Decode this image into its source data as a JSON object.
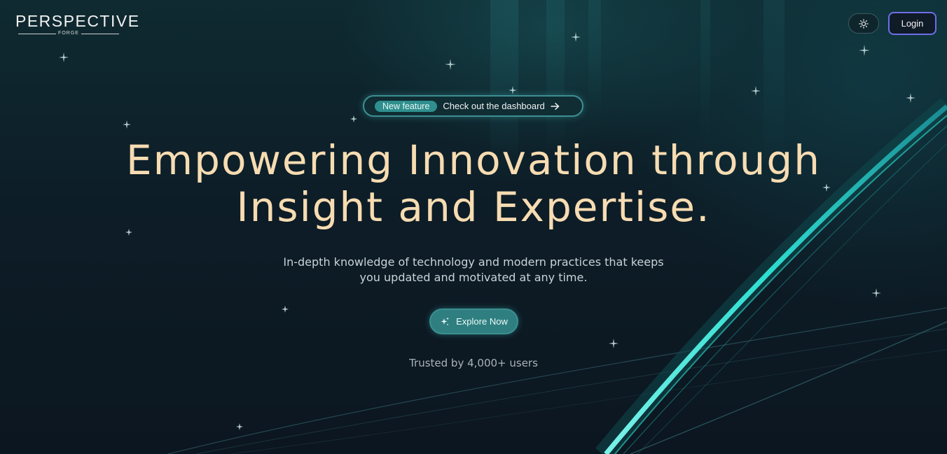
{
  "header": {
    "logo_main": "PERSPECTIVE",
    "logo_sub": "FORGE",
    "login_label": "Login"
  },
  "announcement": {
    "badge": "New feature",
    "text": "Check out the dashboard"
  },
  "hero": {
    "title_line1": "Empowering Innovation through",
    "title_line2": "Insight and Expertise.",
    "subtitle_line1": "In-depth knowledge of technology and modern practices that keeps",
    "subtitle_line2": "you updated and motivated at any time.",
    "cta_label": "Explore Now",
    "trusted_text": "Trusted by 4,000+ users"
  },
  "icons": {
    "theme_toggle": "sun-icon",
    "pill_arrow": "arrow-right-icon",
    "cta_icon": "sparkles-icon"
  },
  "colors": {
    "background": "#0d1a22",
    "headline": "#f7dcb2",
    "accent_teal": "#2f8f8e",
    "login_border": "#6d6ee8",
    "streak": "#39f0e0"
  }
}
